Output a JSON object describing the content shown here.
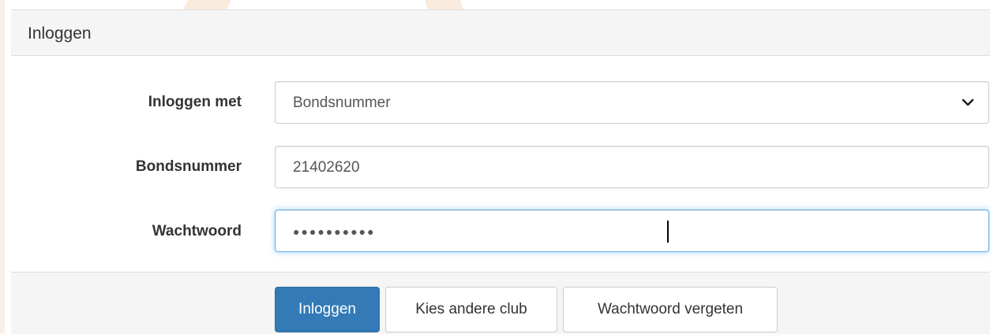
{
  "panel": {
    "title": "Inloggen"
  },
  "form": {
    "login_method": {
      "label": "Inloggen met",
      "selected": "Bondsnummer"
    },
    "member_number": {
      "label": "Bondsnummer",
      "value": "21402620"
    },
    "password": {
      "label": "Wachtwoord",
      "masked_value": "●●●●●●●●●●"
    }
  },
  "buttons": {
    "login": "Inloggen",
    "choose_other_club": "Kies andere club",
    "forgot_password": "Wachtwoord vergeten"
  },
  "colors": {
    "primary": "#337ab7",
    "focus_border": "#66afe9",
    "panel_bg": "#f5f5f5"
  },
  "icons": {
    "select_caret": "chevron-down-icon"
  }
}
